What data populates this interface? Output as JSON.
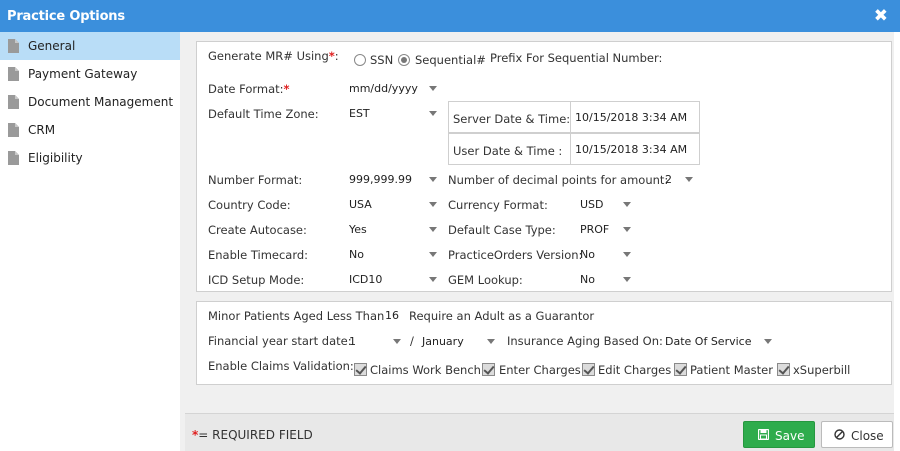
{
  "window": {
    "title": "Practice Options",
    "close_glyph": "✖"
  },
  "sidebar": {
    "items": [
      {
        "label": "General",
        "icon": "document-icon",
        "active": true
      },
      {
        "label": "Payment Gateway",
        "icon": "document-icon"
      },
      {
        "label": "Document Management",
        "icon": "document-icon"
      },
      {
        "label": "CRM",
        "icon": "document-icon"
      },
      {
        "label": "Eligibility",
        "icon": "document-icon"
      }
    ]
  },
  "general": {
    "mr_label": "Generate MR# Using",
    "mr_colon": ":",
    "required_mark": "*",
    "ssn_label": "SSN",
    "sequential_label": "Sequential#",
    "prefix_label": "Prefix For Sequential Number:",
    "date_format_label": "Date Format:",
    "date_format_value": "mm/dd/yyyy",
    "time_zone_label": "Default Time Zone:",
    "time_zone_value": "EST",
    "server_dt_label": "Server Date & Time:",
    "server_dt_value": "10/15/2018 3:34 AM",
    "user_dt_label": "User Date & Time :",
    "user_dt_value": "10/15/2018 3:34 AM",
    "number_format_label": "Number Format:",
    "number_format_value": "999,999.99",
    "decimal_label": "Number of decimal points for amount:",
    "decimal_value": "2",
    "country_code_label": "Country Code:",
    "country_code_value": "USA",
    "currency_label": "Currency Format:",
    "currency_value": "USD",
    "autocase_label": "Create Autocase:",
    "autocase_value": "Yes",
    "case_type_label": "Default Case Type:",
    "case_type_value": "PROF",
    "timecard_label": "Enable Timecard:",
    "timecard_value": "No",
    "po_version_label": "PracticeOrders Version:",
    "po_version_value": "No",
    "icd_label": "ICD Setup Mode:",
    "icd_value": "ICD10",
    "gem_label": "GEM Lookup:",
    "gem_value": "No"
  },
  "guarantor": {
    "minor_label": "Minor Patients Aged Less Than",
    "minor_value": "16",
    "require_label": "Require an Adult as a Guarantor",
    "fy_label": "Financial year start date:",
    "fy_day_value": "1",
    "fy_sep": "/",
    "fy_month_value": "January",
    "aging_label": "Insurance Aging Based On:",
    "aging_value": "Date Of Service",
    "claims_label": "Enable Claims Validation:",
    "claims_options": [
      "Claims Work Bench",
      "Enter Charges",
      "Edit Charges",
      "Patient Master",
      "xSuperbill"
    ]
  },
  "footer": {
    "required_mark": "*",
    "required_note": "= REQUIRED FIELD",
    "save_label": "Save",
    "close_label": "Close"
  },
  "colors": {
    "titlebar": "#3b8fdc",
    "active_item": "#b9ddf7",
    "save_button": "#2eac4c",
    "required": "#e02020"
  }
}
